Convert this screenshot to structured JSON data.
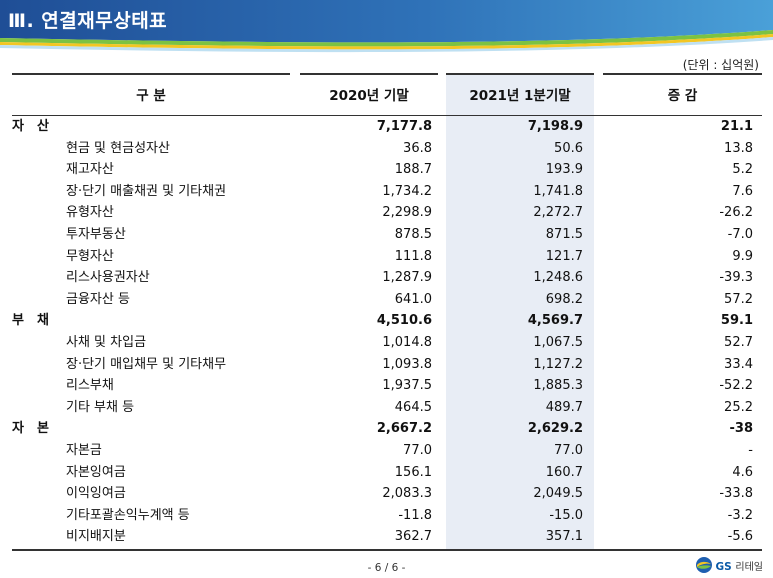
{
  "title": "Ⅲ. 연결재무상태표",
  "unit": "(단위 : 십억원)",
  "headers": {
    "category": "구 분",
    "col1": "2020년 기말",
    "col2": "2021년 1분기말",
    "col3": "증 감"
  },
  "rows": [
    {
      "label": "자산",
      "v1": "7,177.8",
      "v2": "7,198.9",
      "v3": "21.1",
      "main": true
    },
    {
      "label": "현금 및 현금성자산",
      "v1": "36.8",
      "v2": "50.6",
      "v3": "13.8"
    },
    {
      "label": "재고자산",
      "v1": "188.7",
      "v2": "193.9",
      "v3": "5.2"
    },
    {
      "label": "장·단기 매출채권 및 기타채권",
      "v1": "1,734.2",
      "v2": "1,741.8",
      "v3": "7.6"
    },
    {
      "label": "유형자산",
      "v1": "2,298.9",
      "v2": "2,272.7",
      "v3": "-26.2"
    },
    {
      "label": "투자부동산",
      "v1": "878.5",
      "v2": "871.5",
      "v3": "-7.0"
    },
    {
      "label": "무형자산",
      "v1": "111.8",
      "v2": "121.7",
      "v3": "9.9"
    },
    {
      "label": "리스사용권자산",
      "v1": "1,287.9",
      "v2": "1,248.6",
      "v3": "-39.3"
    },
    {
      "label": "금융자산 등",
      "v1": "641.0",
      "v2": "698.2",
      "v3": "57.2"
    },
    {
      "label": "부채",
      "v1": "4,510.6",
      "v2": "4,569.7",
      "v3": "59.1",
      "main": true
    },
    {
      "label": "사채 및 차입금",
      "v1": "1,014.8",
      "v2": "1,067.5",
      "v3": "52.7"
    },
    {
      "label": "장·단기 매입채무 및 기타채무",
      "v1": "1,093.8",
      "v2": "1,127.2",
      "v3": "33.4"
    },
    {
      "label": "리스부채",
      "v1": "1,937.5",
      "v2": "1,885.3",
      "v3": "-52.2"
    },
    {
      "label": "기타 부채 등",
      "v1": "464.5",
      "v2": "489.7",
      "v3": "25.2"
    },
    {
      "label": "자본",
      "v1": "2,667.2",
      "v2": "2,629.2",
      "v3": "-38",
      "main": true
    },
    {
      "label": "자본금",
      "v1": "77.0",
      "v2": "77.0",
      "v3": "-"
    },
    {
      "label": "자본잉여금",
      "v1": "156.1",
      "v2": "160.7",
      "v3": "4.6"
    },
    {
      "label": "이익잉여금",
      "v1": "2,083.3",
      "v2": "2,049.5",
      "v3": "-33.8"
    },
    {
      "label": "기타포괄손익누계액 등",
      "v1": "-11.8",
      "v2": "-15.0",
      "v3": "-3.2"
    },
    {
      "label": "비지배지분",
      "v1": "362.7",
      "v2": "357.1",
      "v3": "-5.6"
    }
  ],
  "footer": "- 6 / 6 -",
  "logo": {
    "brand": "GS",
    "suffix": "리테일"
  },
  "colors": {
    "banner_dark": "#1f4e96",
    "banner_light": "#3a86c8",
    "wave_green": "#7cc242",
    "wave_yellow": "#f3c623",
    "highlight": "#e8edf5"
  }
}
